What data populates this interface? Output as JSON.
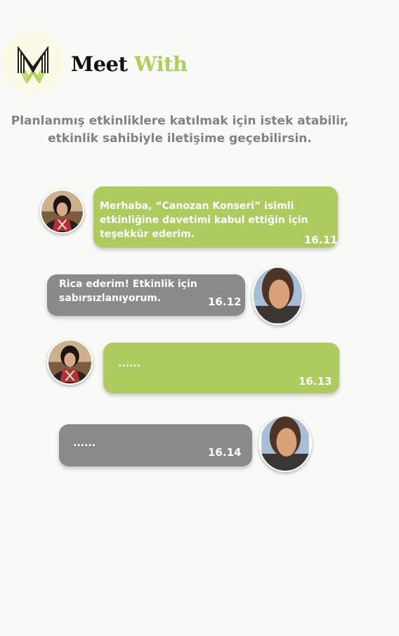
{
  "brand": {
    "word1": "Meet",
    "word2": "With"
  },
  "tagline": "Planlanmış etkinliklere katılmak için istek atabilir, etkinlik sahibiyle iletişime geçebilirsin.",
  "messages": [
    {
      "text": "Merhaba, “Canozan Konseri” isimli\netkinliğine davetimi kabul ettiğin için\nteşekkür ederim.",
      "time": "16.11"
    },
    {
      "text": "Rica ederim! Etkinlik için\nsabırsızlanıyorum.",
      "time": "16.12"
    },
    {
      "text": "......",
      "time": "16.13"
    },
    {
      "text": "......",
      "time": "16.14"
    }
  ],
  "colors": {
    "green_bubble": "#aecb5f",
    "gray_bubble": "#8a8a8a",
    "brand_accent": "#aecf5c",
    "tagline": "#828282"
  }
}
